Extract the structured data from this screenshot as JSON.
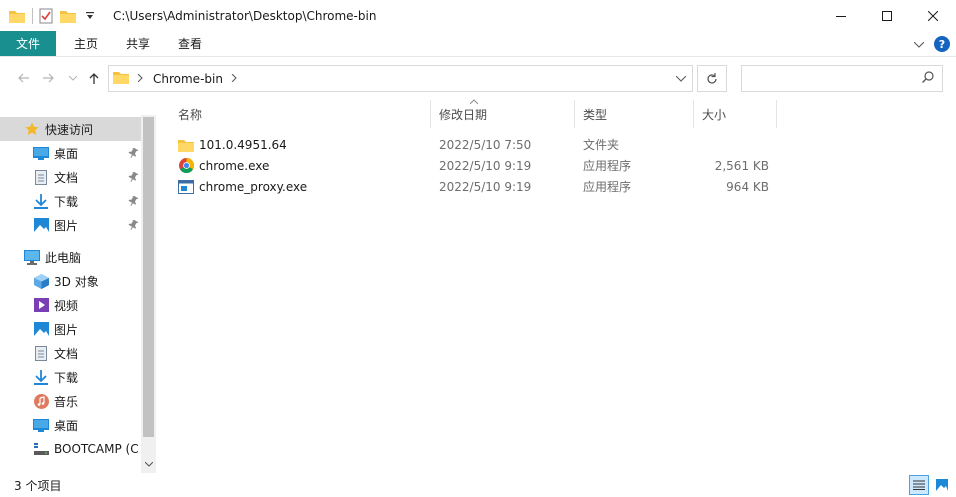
{
  "window": {
    "title": "C:\\Users\\Administrator\\Desktop\\Chrome-bin",
    "controls": {
      "minimize": "—",
      "maximize": "☐",
      "close": "✕"
    }
  },
  "ribbon": {
    "tabs": [
      "文件",
      "主页",
      "共享",
      "查看"
    ],
    "help": "?"
  },
  "address": {
    "crumbs": [
      "Chrome-bin"
    ],
    "search_placeholder": ""
  },
  "nav": {
    "items": [
      {
        "label": "快速访问",
        "icon": "star-icon",
        "level": 0,
        "selected": true
      },
      {
        "label": "桌面",
        "icon": "desktop-icon",
        "level": 1,
        "pinned": true
      },
      {
        "label": "文档",
        "icon": "document-icon",
        "level": 1,
        "pinned": true
      },
      {
        "label": "下载",
        "icon": "download-icon",
        "level": 1,
        "pinned": true
      },
      {
        "label": "图片",
        "icon": "pictures-icon",
        "level": 1,
        "pinned": true
      },
      {
        "label": "此电脑",
        "icon": "computer-icon",
        "level": 0,
        "gap": true
      },
      {
        "label": "3D 对象",
        "icon": "3d-objects-icon",
        "level": 1
      },
      {
        "label": "视频",
        "icon": "video-icon",
        "level": 1
      },
      {
        "label": "图片",
        "icon": "pictures-icon",
        "level": 1
      },
      {
        "label": "文档",
        "icon": "document-icon",
        "level": 1
      },
      {
        "label": "下载",
        "icon": "download-icon",
        "level": 1
      },
      {
        "label": "音乐",
        "icon": "music-icon",
        "level": 1
      },
      {
        "label": "桌面",
        "icon": "desktop-icon",
        "level": 1
      },
      {
        "label": "BOOTCAMP (C",
        "icon": "drive-icon",
        "level": 1
      }
    ]
  },
  "columns": {
    "name": "名称",
    "date": "修改日期",
    "type": "类型",
    "size": "大小"
  },
  "files": [
    {
      "name": "101.0.4951.64",
      "date": "2022/5/10 7:50",
      "type": "文件夹",
      "size": "",
      "icon": "folder-icon"
    },
    {
      "name": "chrome.exe",
      "date": "2022/5/10 9:19",
      "type": "应用程序",
      "size": "2,561 KB",
      "icon": "chrome-icon"
    },
    {
      "name": "chrome_proxy.exe",
      "date": "2022/5/10 9:19",
      "type": "应用程序",
      "size": "964 KB",
      "icon": "app-icon"
    }
  ],
  "status": {
    "count": "3 个项目"
  },
  "colors": {
    "file_tab": "#1a8f8f",
    "selection": "#d9d9d9",
    "folder": "#f5c242",
    "help": "#1565c0"
  }
}
